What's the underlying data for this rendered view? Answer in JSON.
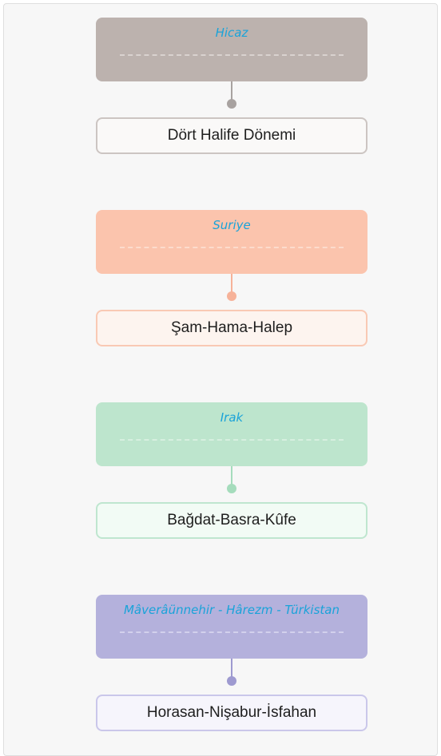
{
  "regions": [
    {
      "region": "Hicaz",
      "cities": "Dört Halife Dönemi"
    },
    {
      "region": "Suriye",
      "cities": "Şam-Hama-Halep"
    },
    {
      "region": "Irak",
      "cities": "Bağdat-Basra-Kûfe"
    },
    {
      "region": "Mâverâünnehir - Hârezm - Türkistan",
      "cities": "Horasan-Nişabur-İsfahan"
    }
  ]
}
